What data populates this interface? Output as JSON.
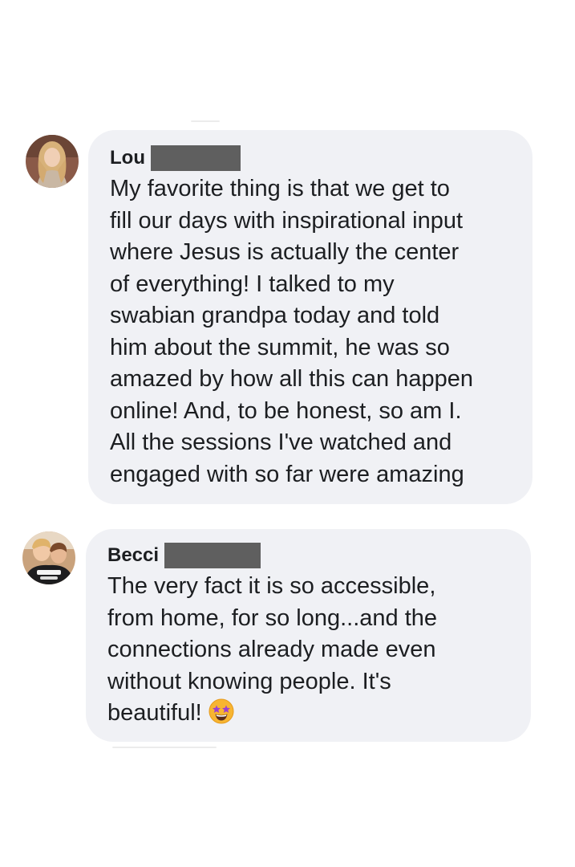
{
  "comments": [
    {
      "author": "Lou",
      "lines": [
        "My favorite thing is that we get to",
        "fill our days with inspirational input",
        "where Jesus is actually the center",
        "of everything! I talked to my",
        "swabian grandpa today and told",
        "him about the summit, he was so",
        "amazed by how all this can happen",
        "online! And, to be honest, so am I.",
        "All the sessions I've watched and",
        "engaged with so far were amazing"
      ]
    },
    {
      "author": "Becci",
      "lines": [
        "The very fact it is so accessible,",
        "from home, for so long...and the",
        "connections already made even",
        "without knowing people. It's",
        "beautiful!"
      ],
      "emoji": "star-struck-emoji-icon"
    }
  ],
  "colors": {
    "bubble": "#f0f1f5",
    "text": "#1c1e21",
    "redaction": "#5f5f5f"
  }
}
